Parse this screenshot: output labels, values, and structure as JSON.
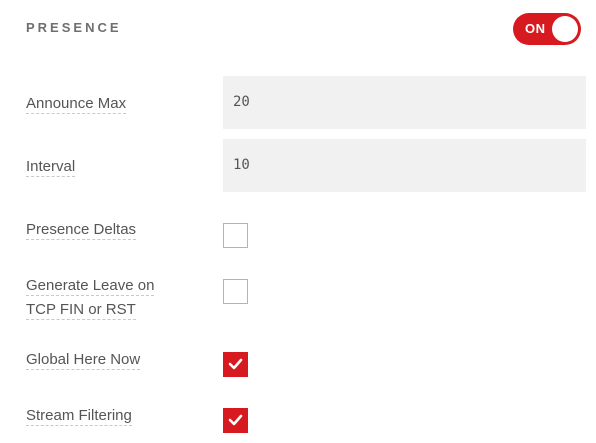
{
  "section": {
    "title": "PRESENCE",
    "toggle": {
      "label": "ON",
      "state": "on",
      "color": "#d71a1f"
    }
  },
  "fields": {
    "announce_max": {
      "label": "Announce Max",
      "value": "20"
    },
    "interval": {
      "label": "Interval",
      "value": "10"
    },
    "presence_deltas": {
      "label": "Presence Deltas",
      "checked": false
    },
    "generate_leave": {
      "label_line1": "Generate Leave on",
      "label_line2": "TCP FIN or RST",
      "checked": false
    },
    "global_here_now": {
      "label": "Global Here Now",
      "checked": true,
      "icon": "checkmark-icon"
    },
    "stream_filtering": {
      "label": "Stream Filtering",
      "checked": true,
      "icon": "checkmark-icon"
    }
  }
}
